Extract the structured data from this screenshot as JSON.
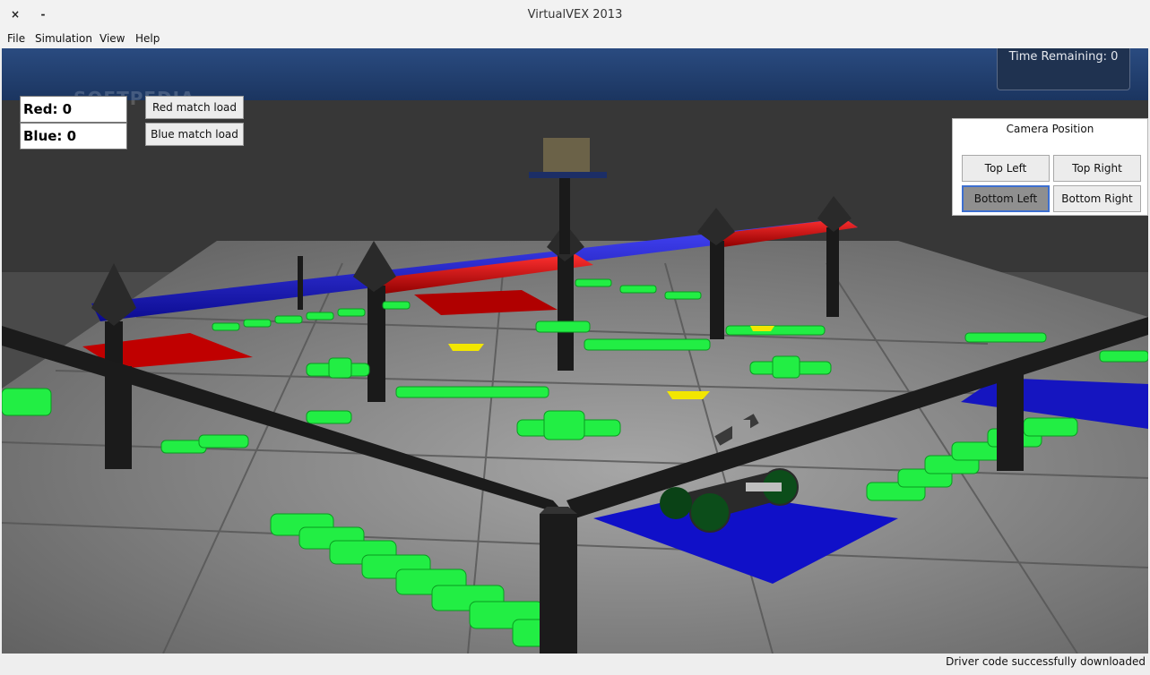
{
  "window": {
    "title": "VirtualVEX 2013",
    "close_glyph": "×",
    "minimize_glyph": "-"
  },
  "menu": {
    "items": [
      "File",
      "Simulation",
      "View",
      "Help"
    ]
  },
  "scoreboard": {
    "red_label": "Red: 0",
    "blue_label": "Blue: 0"
  },
  "match_load": {
    "red_button": "Red match load",
    "blue_button": "Blue match load"
  },
  "timer": {
    "label": "Time Remaining: 0"
  },
  "camera": {
    "title": "Camera Position",
    "buttons": [
      "Top Left",
      "Top Right",
      "Bottom Left",
      "Bottom Right"
    ],
    "selected": "Bottom Left"
  },
  "watermark": "SOFTPEDIA",
  "status": {
    "message": "Driver code successfully downloaded"
  },
  "colors": {
    "sky": "#1f3a68",
    "field_floor": "#8a8a8a",
    "tile_dark": "#6f6f6f",
    "red_zone": "#c00000",
    "blue_zone": "#1010c8",
    "green_object": "#22ee44",
    "yellow_object": "#f2e600",
    "frame": "#1b1b1b"
  }
}
